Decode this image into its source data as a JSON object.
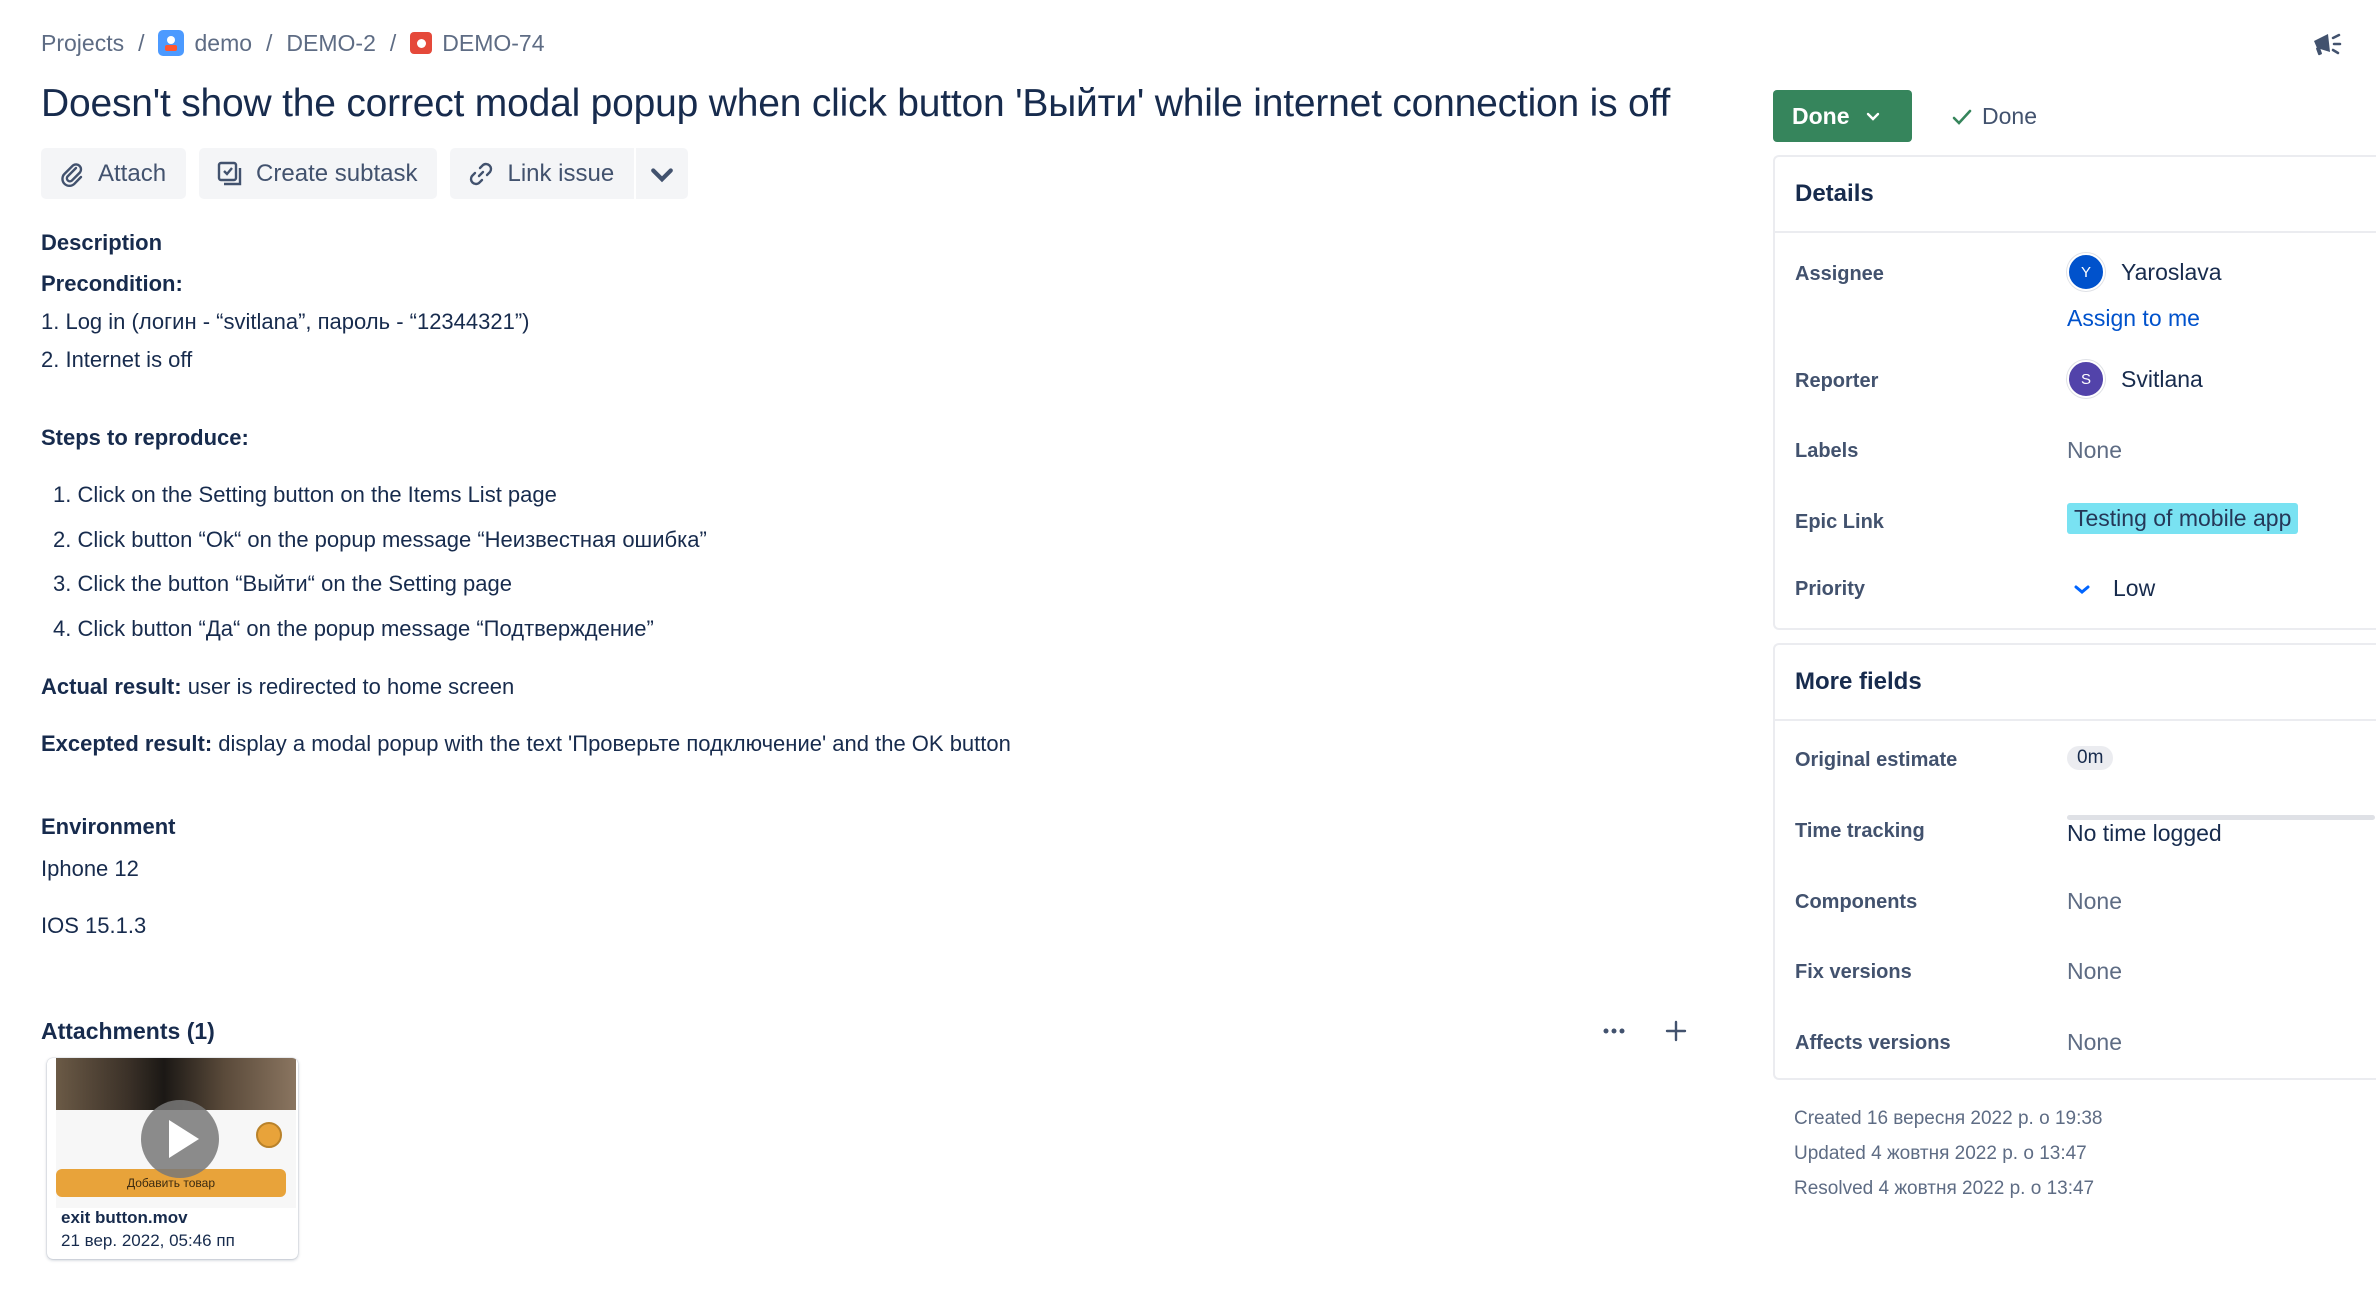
{
  "breadcrumb": {
    "projects": "Projects",
    "project": "demo",
    "parent": "DEMO-2",
    "issue_key": "DEMO-74"
  },
  "issue": {
    "title": "Doesn't show the correct modal popup when click button 'Выйти' while internet connection is off"
  },
  "toolbar": {
    "attach": "Attach",
    "create_subtask": "Create subtask",
    "link_issue": "Link issue"
  },
  "description": {
    "heading": "Description",
    "precondition_label": "Precondition:",
    "precondition_1": "1. Log in (логин - “svitlana”, пароль - “12344321”)",
    "precondition_2": "2. Internet is off",
    "steps_label": "Steps to reproduce:",
    "steps": [
      "1. Click on the Setting button on the Items List page",
      "2. Click button “Ok“ on the popup message “Неизвестная ошибка”",
      "3. Click the button “Выйти“ on the Setting page",
      "4. Click button “Да“ on the popup message “Подтверждение”"
    ],
    "actual_label": "Actual result:",
    "actual_text": " user is redirected to home screen",
    "expected_label": "Excepted result:",
    "expected_text": " display a modal popup with the text 'Проверьте подключение' and the OK button"
  },
  "environment": {
    "heading": "Environment",
    "device": "Iphone 12",
    "os": "IOS 15.1.3"
  },
  "attachments": {
    "heading": "Attachments (1)",
    "file_name": "exit button.mov",
    "file_date": "21 вер. 2022, 05:46 пп",
    "thumb_button_text": "Добавить товар"
  },
  "status": {
    "button": "Done",
    "resolution": "Done",
    "button_color": "#36855c"
  },
  "details": {
    "heading": "Details",
    "assignee_label": "Assignee",
    "assignee_initial": "Y",
    "assignee_name": "Yaroslava",
    "assignee_color": "#0052cc",
    "assign_to_me": "Assign to me",
    "reporter_label": "Reporter",
    "reporter_initial": "S",
    "reporter_name": "Svitlana",
    "reporter_color": "#5243aa",
    "labels_label": "Labels",
    "labels_value": "None",
    "epic_label": "Epic Link",
    "epic_value": "Testing of mobile app",
    "epic_color": "#79e2f2",
    "priority_label": "Priority",
    "priority_value": "Low"
  },
  "more_fields": {
    "heading": "More fields",
    "original_estimate_label": "Original estimate",
    "original_estimate_value": "0m",
    "time_tracking_label": "Time tracking",
    "time_tracking_value": "No time logged",
    "components_label": "Components",
    "components_value": "None",
    "fix_versions_label": "Fix versions",
    "fix_versions_value": "None",
    "affects_versions_label": "Affects versions",
    "affects_versions_value": "None"
  },
  "dates": {
    "created": "Created 16 вересня 2022 р. о 19:38",
    "updated": "Updated 4 жовтня 2022 р. о 13:47",
    "resolved": "Resolved 4 жовтня 2022 р. о 13:47"
  },
  "icons": [
    "project-avatar-icon",
    "bug-icon",
    "megaphone-icon",
    "paperclip-icon",
    "subtask-icon",
    "link-icon",
    "chevron-down-icon",
    "more-icon",
    "plus-icon",
    "play-icon",
    "check-icon",
    "priority-low-icon"
  ]
}
